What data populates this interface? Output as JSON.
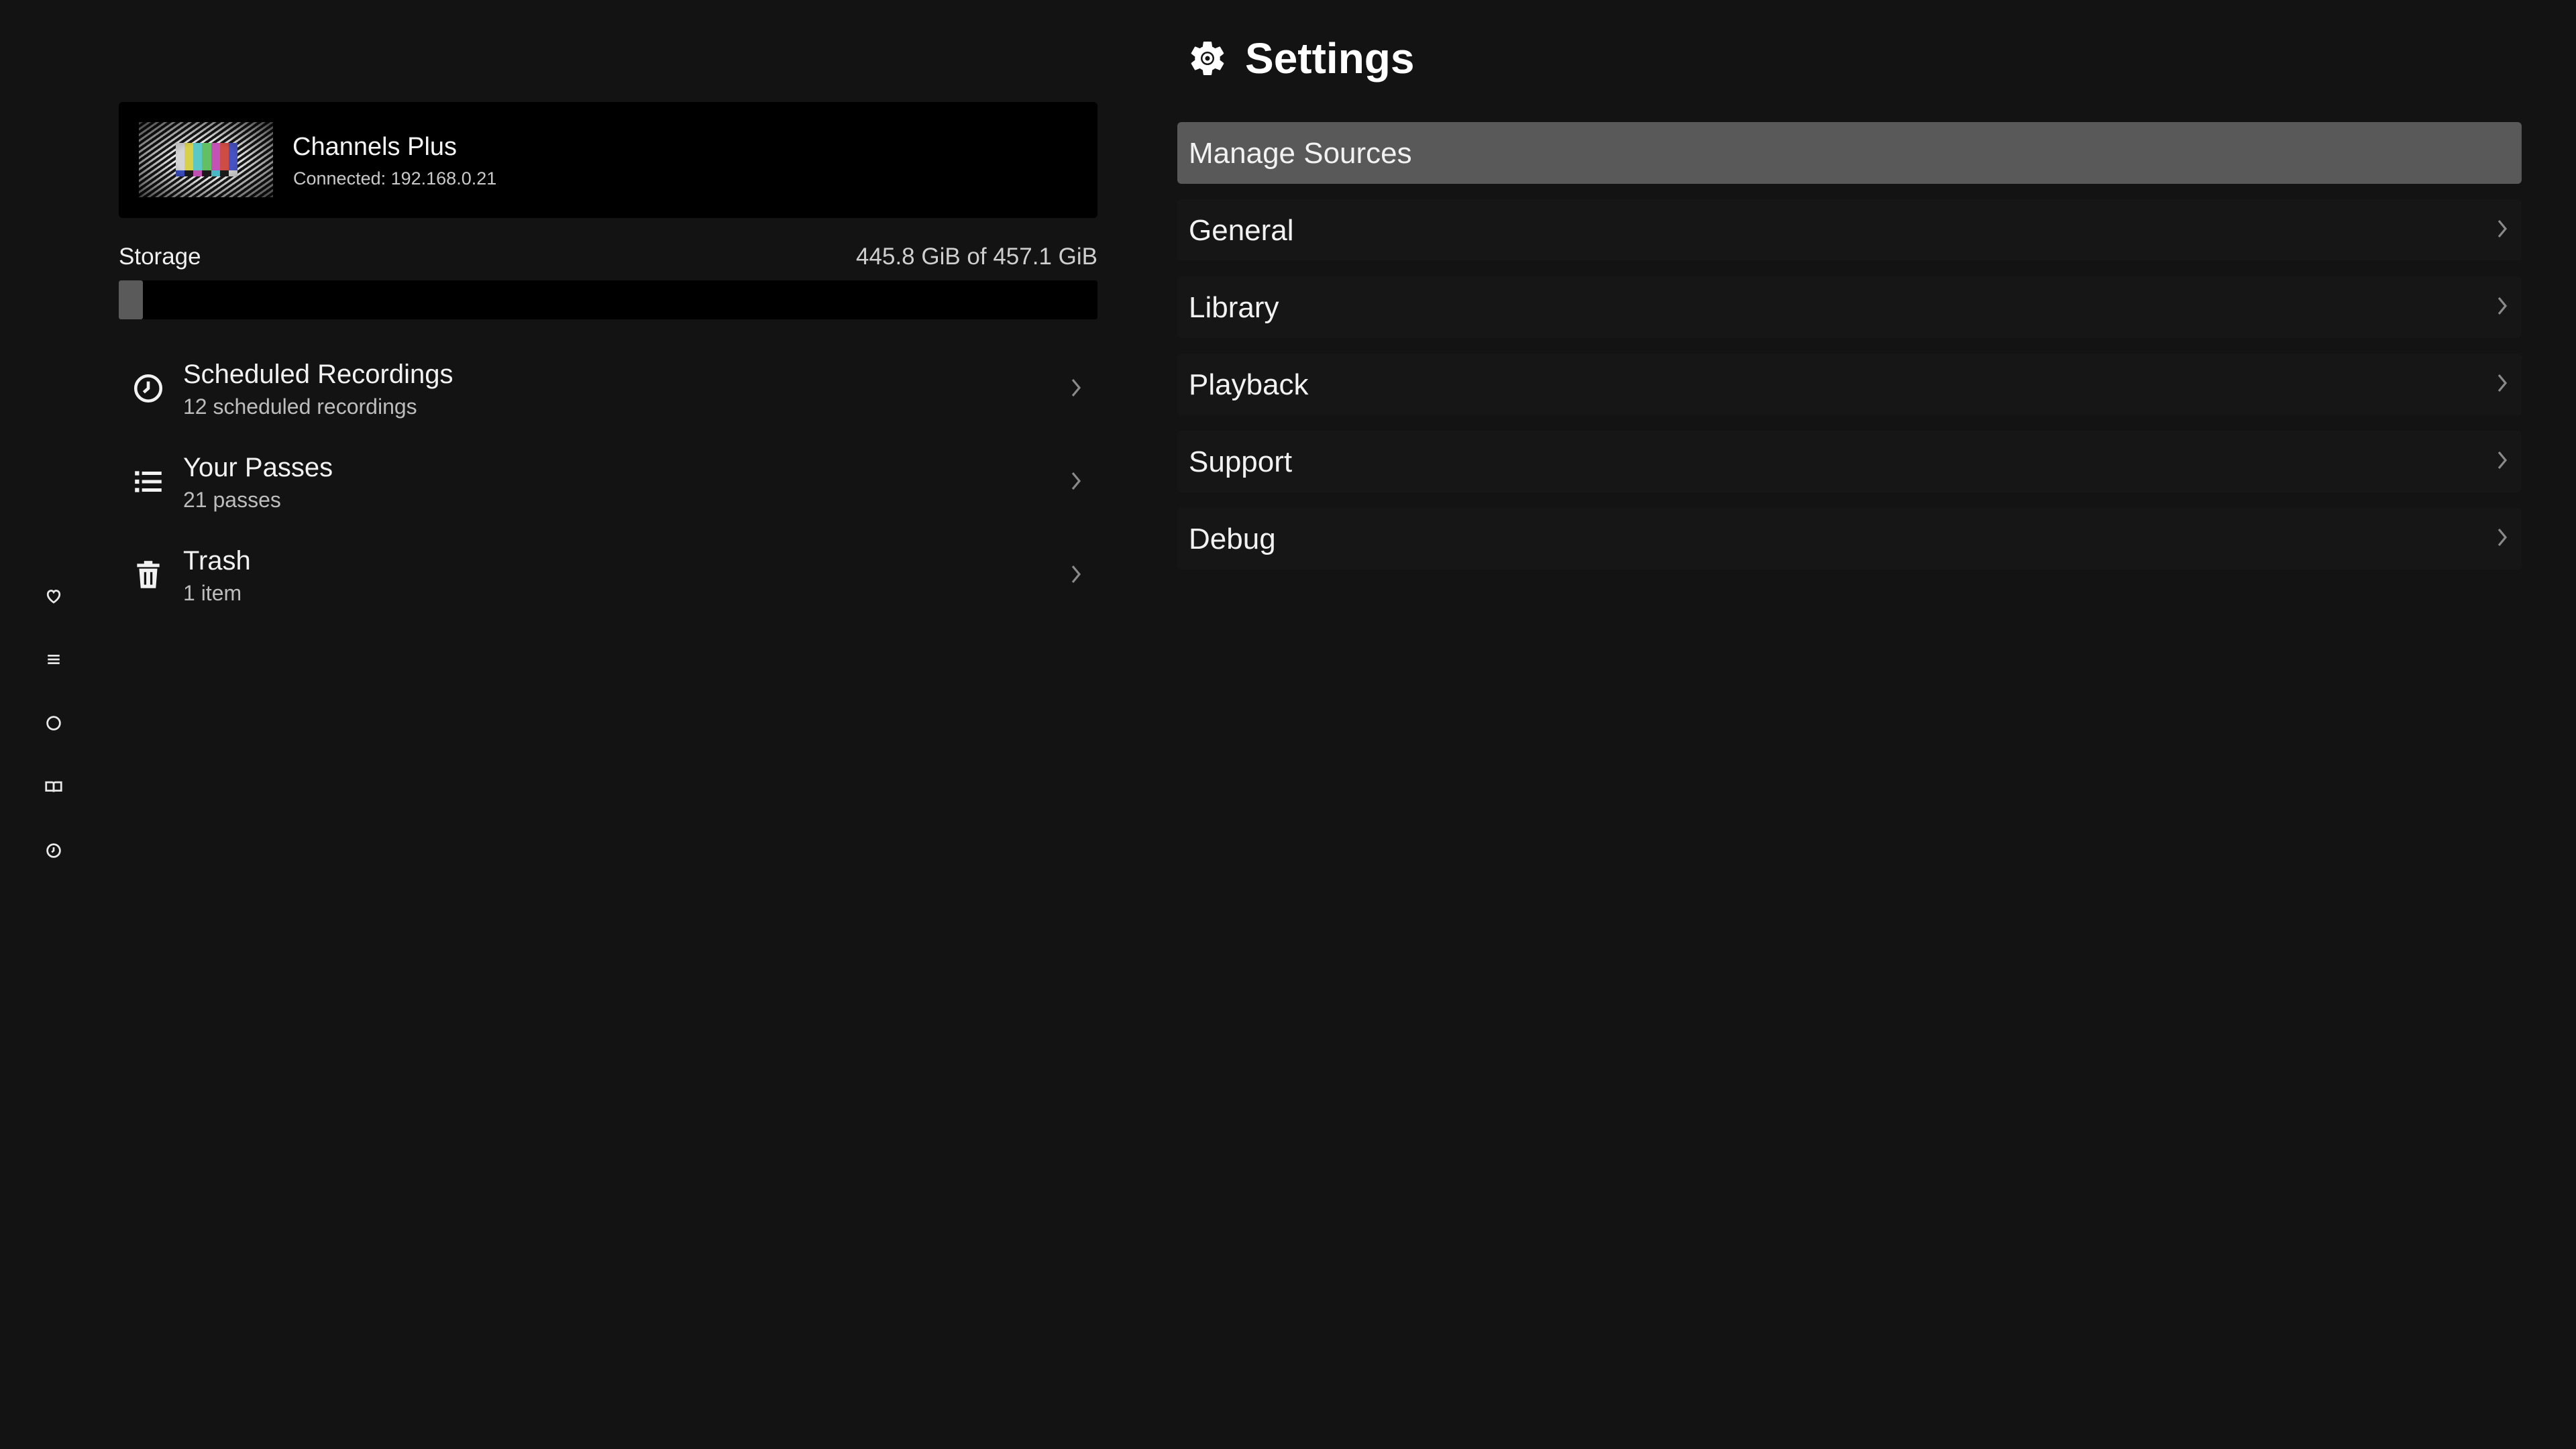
{
  "server": {
    "name": "Channels Plus",
    "status": "Connected: 192.168.0.21",
    "thumbnail_icon": "color-bars-thumbnail",
    "color_bars": [
      "#d4d4d4",
      "#d9d04a",
      "#5bc8c6",
      "#63c062",
      "#c451b5",
      "#cd4c43",
      "#4753c4"
    ]
  },
  "storage": {
    "label": "Storage",
    "value_text": "445.8 GiB of 457.1 GiB",
    "used_fraction": 0.0247,
    "bar_color": "#5a5a5a"
  },
  "left_list": [
    {
      "title": "Scheduled Recordings",
      "subtitle": "12 scheduled recordings",
      "icon": "clock-icon"
    },
    {
      "title": "Your Passes",
      "subtitle": "21 passes",
      "icon": "list-icon"
    },
    {
      "title": "Trash",
      "subtitle": "1 item",
      "icon": "trash-icon"
    }
  ],
  "rail": {
    "icons": [
      "heart-icon",
      "menu-icon",
      "circle-icon",
      "book-icon",
      "clock-icon"
    ]
  },
  "settings": {
    "title": "Settings",
    "title_icon": "gear-icon",
    "items": [
      {
        "label": "Manage Sources",
        "active": true
      },
      {
        "label": "General"
      },
      {
        "label": "Library"
      },
      {
        "label": "Playback"
      },
      {
        "label": "Support"
      },
      {
        "label": "Debug"
      }
    ]
  },
  "colors": {
    "background": "#131313",
    "card": "#000000",
    "highlight": "#595959"
  }
}
